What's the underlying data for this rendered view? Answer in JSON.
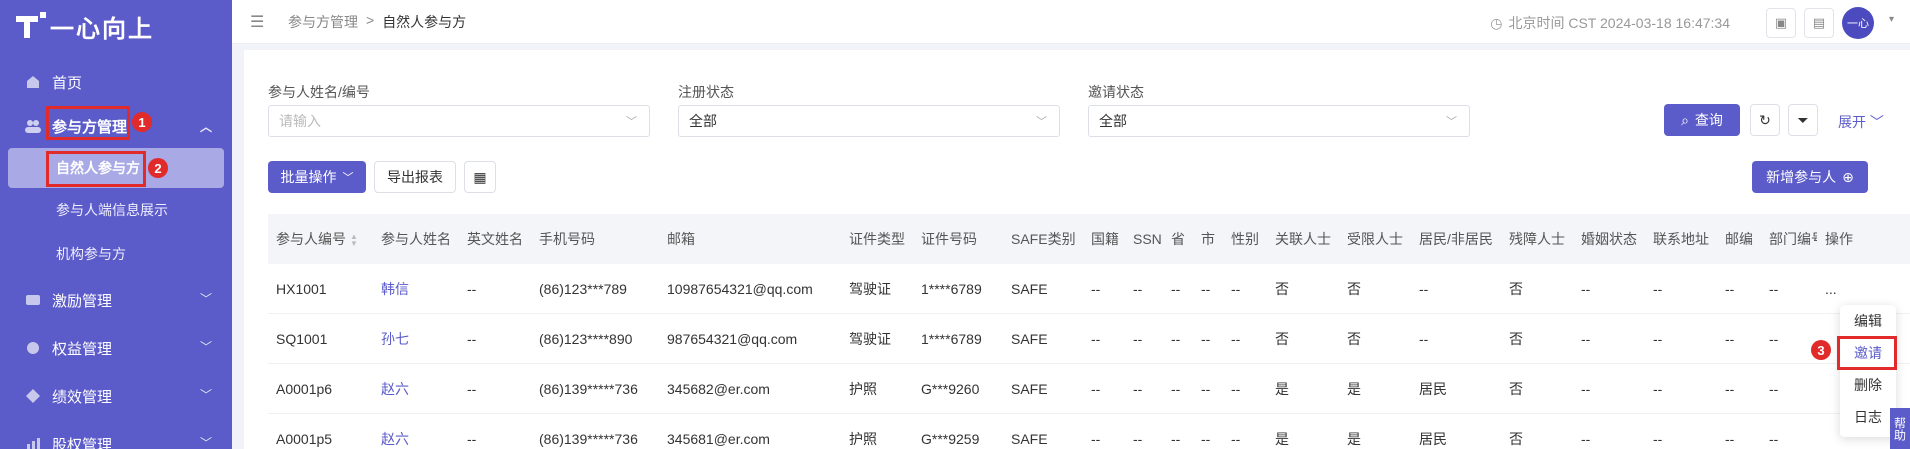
{
  "logo": {
    "text": "一心向上"
  },
  "sidebar": {
    "items": [
      {
        "label": "首页",
        "icon": "home-icon"
      },
      {
        "label": "参与方管理",
        "icon": "users-icon",
        "expanded": true
      },
      {
        "label": "激励管理",
        "icon": "incentive-icon"
      },
      {
        "label": "权益管理",
        "icon": "equity-icon"
      },
      {
        "label": "绩效管理",
        "icon": "performance-icon"
      },
      {
        "label": "股权管理",
        "icon": "stock-icon"
      }
    ],
    "subitems": [
      {
        "label": "自然人参与方",
        "active": true
      },
      {
        "label": "参与人端信息展示"
      },
      {
        "label": "机构参与方"
      }
    ]
  },
  "annotations": {
    "badge1": "1",
    "badge2": "2",
    "badge3": "3"
  },
  "topbar": {
    "breadcrumb": [
      "参与方管理",
      ">",
      "自然人参与方"
    ],
    "clock": "北京时间 CST 2024-03-18 16:47:34",
    "avatar_text": "一心"
  },
  "filters": [
    {
      "label": "参与人姓名/编号",
      "placeholder": "请输入",
      "value": ""
    },
    {
      "label": "注册状态",
      "placeholder": "",
      "value": "全部"
    },
    {
      "label": "邀请状态",
      "placeholder": "",
      "value": "全部"
    }
  ],
  "actions": {
    "query": "查询",
    "expand": "展开",
    "batch": "批量操作",
    "export": "导出报表",
    "add": "新增参与人"
  },
  "table": {
    "columns": [
      "参与人编号",
      "参与人姓名",
      "英文姓名",
      "手机号码",
      "邮箱",
      "证件类型",
      "证件号码",
      "SAFE类别",
      "国籍",
      "SSN",
      "省",
      "市",
      "性别",
      "关联人士",
      "受限人士",
      "居民/非居民",
      "残障人士",
      "婚姻状态",
      "联系地址",
      "邮编",
      "部门编号",
      "操作"
    ],
    "rows": [
      [
        "HX1001",
        "韩信",
        "--",
        "(86)123***789",
        "10987654321@qq.com",
        "驾驶证",
        "1****6789",
        "SAFE",
        "--",
        "--",
        "--",
        "--",
        "--",
        "否",
        "否",
        "--",
        "否",
        "--",
        "--",
        "--",
        "--",
        "..."
      ],
      [
        "SQ1001",
        "孙七",
        "--",
        "(86)123****890",
        "987654321@qq.com",
        "驾驶证",
        "1****6789",
        "SAFE",
        "--",
        "--",
        "--",
        "--",
        "--",
        "否",
        "否",
        "--",
        "否",
        "--",
        "--",
        "--",
        "--",
        ""
      ],
      [
        "A0001p6",
        "赵六",
        "--",
        "(86)139*****736",
        "345682@er.com",
        "护照",
        "G***9260",
        "SAFE",
        "--",
        "--",
        "--",
        "--",
        "--",
        "是",
        "是",
        "居民",
        "否",
        "--",
        "--",
        "--",
        "--",
        ""
      ],
      [
        "A0001p5",
        "赵六",
        "--",
        "(86)139*****736",
        "345681@er.com",
        "护照",
        "G***9259",
        "SAFE",
        "--",
        "--",
        "--",
        "--",
        "--",
        "是",
        "是",
        "居民",
        "否",
        "--",
        "--",
        "--",
        "--",
        ""
      ]
    ]
  },
  "row_menu": [
    "编辑",
    "邀请",
    "删除",
    "日志"
  ],
  "help_tab": "帮助",
  "colors": {
    "primary": "#5b5bc9",
    "annotation": "#e12a2a"
  }
}
